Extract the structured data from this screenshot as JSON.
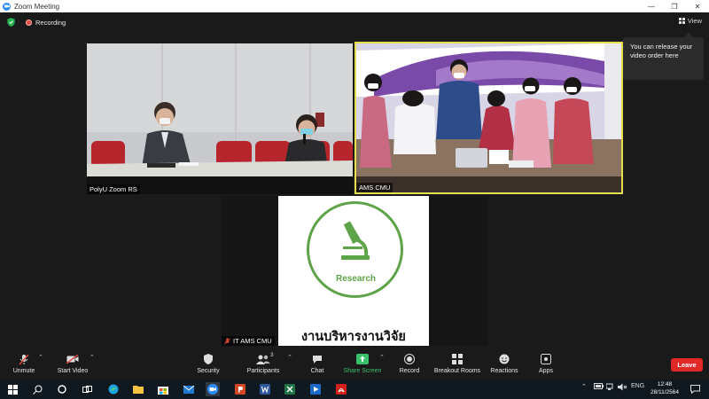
{
  "window": {
    "title": "Zoom Meeting",
    "controls": {
      "minimize": "—",
      "restore": "❐",
      "close": "✕"
    }
  },
  "topbar": {
    "recording_label": "Recording",
    "view_label": "View"
  },
  "tooltip": {
    "text": "You can release your video order here"
  },
  "tiles": {
    "polyu": {
      "name": "PolyU Zoom RS"
    },
    "ams": {
      "name": "AMS CMU"
    },
    "it": {
      "name": "IT AMS CMU"
    }
  },
  "slide": {
    "label": "Research",
    "thai_text": "งานบริหารงานวิจัย"
  },
  "toolbar": {
    "unmute": "Unmute",
    "start_video": "Start Video",
    "security": "Security",
    "participants": "Participants",
    "participants_count": "3",
    "chat": "Chat",
    "share_screen": "Share Screen",
    "record": "Record",
    "breakout_rooms": "Breakout Rooms",
    "reactions": "Reactions",
    "apps": "Apps",
    "leave": "Leave"
  },
  "taskbar": {
    "language": "ENG",
    "time": "12:48",
    "date": "28/11/2564"
  },
  "colors": {
    "accent_green": "#5da348",
    "share_green": "#39c06b",
    "leave_red": "#e02828",
    "active_speaker": "#e6de4f",
    "zoom_blue": "#2d8cff"
  }
}
